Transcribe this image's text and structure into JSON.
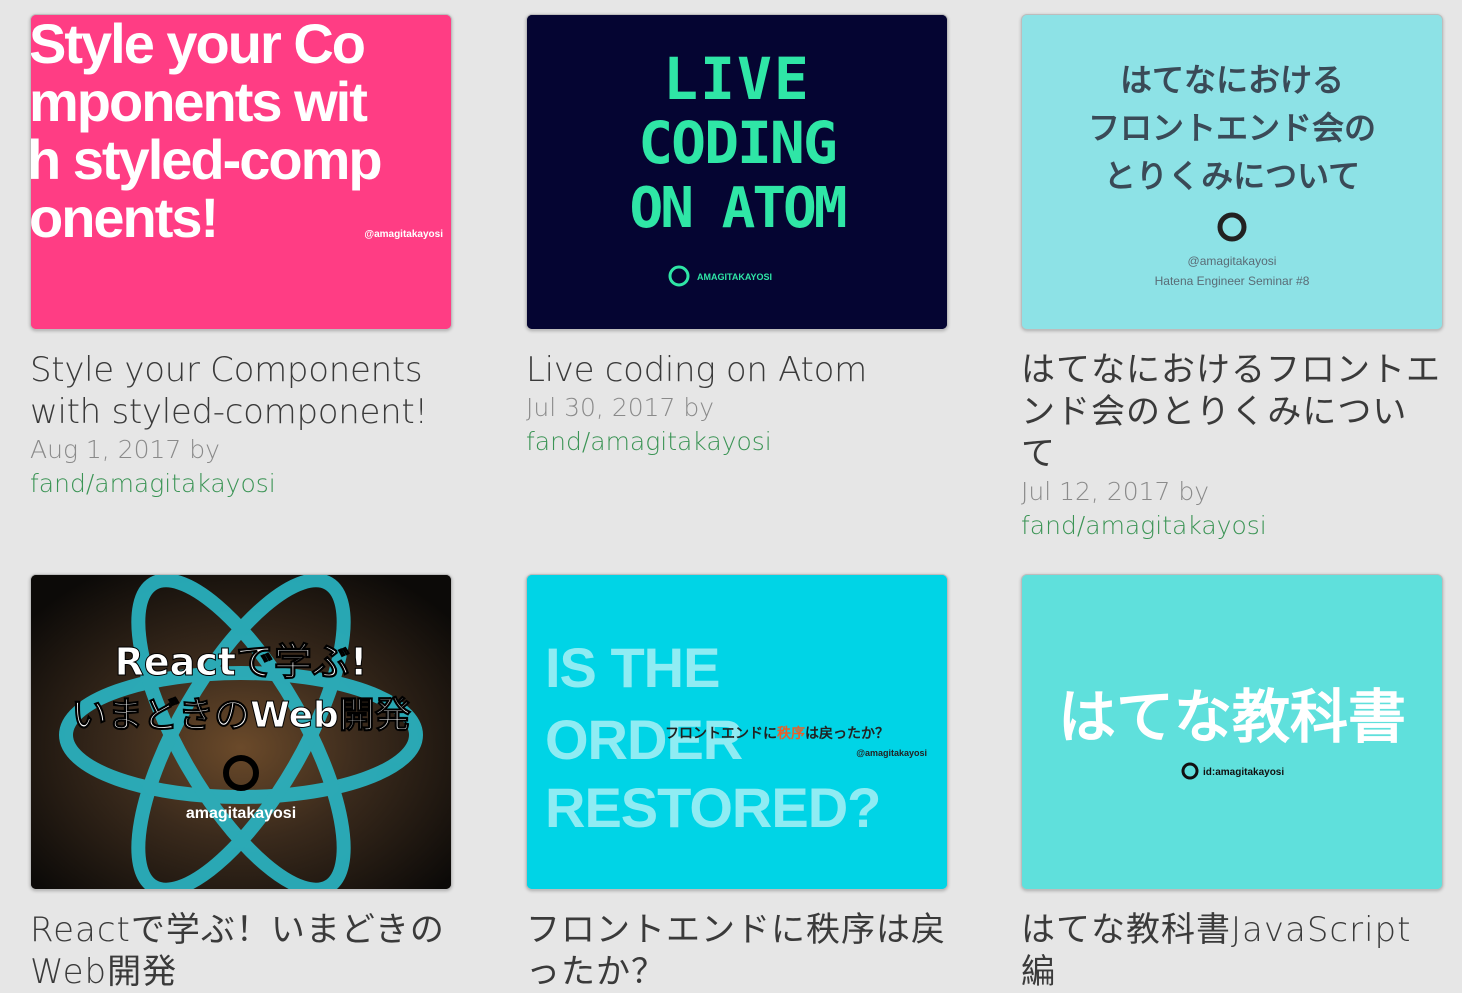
{
  "cards": [
    {
      "title": "Style your Components with styled-component!",
      "date": "Aug 1, 2017",
      "by": "by",
      "author": "fand/amagitakayosi",
      "thumb": {
        "bg": "#ff3d84",
        "lines": [
          "Style your Co",
          "mponents wit",
          "h styled-comp",
          "onents!"
        ],
        "handle": "@amagitakayosi"
      }
    },
    {
      "title": "Live coding on Atom",
      "date": "Jul 30, 2017",
      "by": "by",
      "author": "fand/amagitakayosi",
      "thumb": {
        "bg": "#050532",
        "accent": "#2fe6a6",
        "lines": [
          "LIVE",
          "CODING",
          "ON ATOM"
        ],
        "handle": "AMAGITAKAYOSI"
      }
    },
    {
      "title": "はてなにおけるフロントエンド会のとりくみについて",
      "date": "Jul 12, 2017",
      "by": "by",
      "author": "fand/amagitakayosi",
      "thumb": {
        "bg": "#8de2e6",
        "lines": [
          "はてなにおける",
          "フロントエンド会の",
          "とりくみについて"
        ],
        "handle": "@amagitakayosi",
        "event": "Hatena Engineer Seminar #8"
      }
    },
    {
      "title": "Reactで学ぶ！いまどきのWeb開発",
      "thumb": {
        "bg": "#1a1410",
        "lines": [
          "Reactで学ぶ!",
          "いまどきのWeb開発"
        ],
        "handle": "amagitakayosi"
      }
    },
    {
      "title": "フロントエンドに秩序は戻ったか？",
      "thumb": {
        "bg": "#00d4e6",
        "lines": [
          "IS THE",
          "ORDER",
          "RESTORED?"
        ],
        "subtitle_a": "フロントエンドに",
        "subtitle_b": "秩序",
        "subtitle_c": "は戻ったか？",
        "handle": "@amagitakayosi"
      }
    },
    {
      "title": "はてな教科書JavaScript編",
      "thumb": {
        "bg": "#5fe0dc",
        "lines": [
          "はてな教科書"
        ],
        "handle": "id:amagitakayosi"
      }
    }
  ]
}
